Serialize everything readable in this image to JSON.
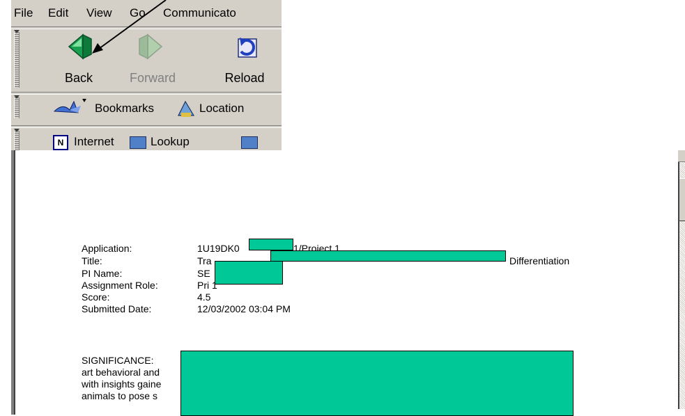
{
  "menubar": {
    "items": [
      "File",
      "Edit",
      "View",
      "Go",
      "Communicato"
    ]
  },
  "nav": {
    "back": "Back",
    "forward": "Forward",
    "reload": "Reload"
  },
  "personal_toolbar": {
    "bookmarks": "Bookmarks",
    "location": "Location"
  },
  "links_toolbar": {
    "internet": "Internet",
    "lookup": "Lookup"
  },
  "record": {
    "labels": {
      "application": "Application:",
      "title": "Title:",
      "pi_name": "PI Name:",
      "assignment_role": "Assignment Role:",
      "score": "Score:",
      "submitted_date": "Submitted Date:"
    },
    "values": {
      "application_prefix": "1U19DK0",
      "application_suffix": "1/Project 1",
      "title_prefix": "Tra",
      "title_suffix": "Differentiation",
      "pi_name": "SE",
      "assignment_role": "Pri 1",
      "score": "4.5",
      "submitted_date": "12/03/2002 03:04 PM"
    }
  },
  "body": {
    "lines": [
      "SIGNIFICANCE:",
      "art behavioral and",
      "with insights gaine",
      "animals to pose s"
    ]
  },
  "colors": {
    "redaction": "#00c896",
    "chrome": "#d4d0c8"
  }
}
